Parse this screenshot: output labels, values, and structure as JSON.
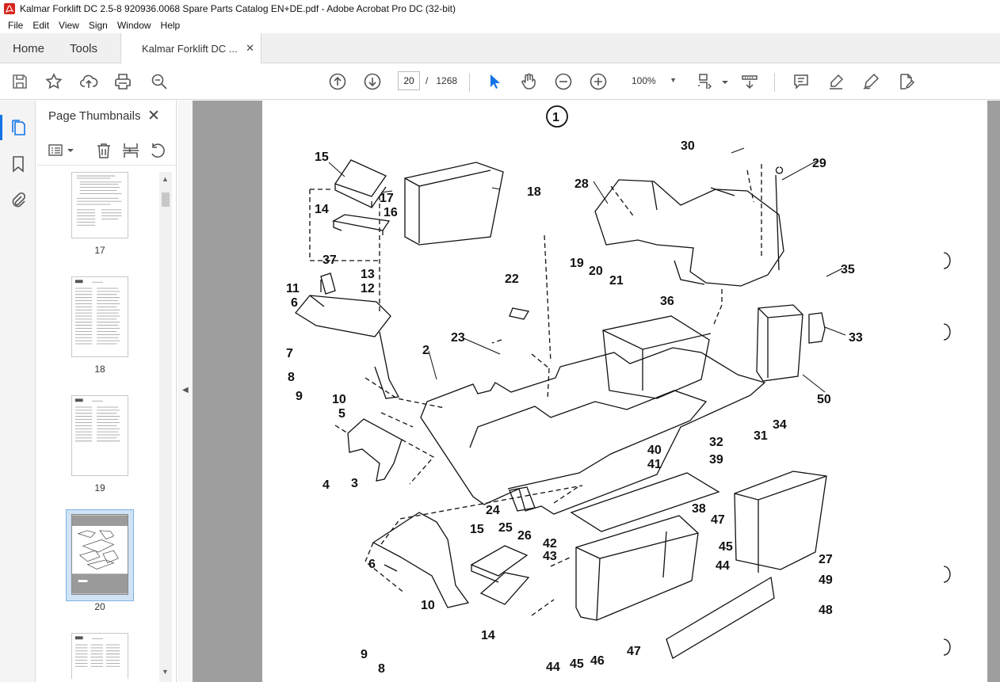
{
  "window": {
    "title": "Kalmar Forklift DC 2.5-8 920936.0068 Spare Parts Catalog EN+DE.pdf - Adobe Acrobat Pro DC (32-bit)"
  },
  "menu": [
    "File",
    "Edit",
    "View",
    "Sign",
    "Window",
    "Help"
  ],
  "tabs": {
    "home": "Home",
    "tools": "Tools",
    "document": "Kalmar Forklift DC ...",
    "close": "✕"
  },
  "toolbar": {
    "icons": [
      "save-icon",
      "bookmark-star-icon",
      "upload-cloud-icon",
      "print-icon",
      "zoom-find-icon",
      "page-up-icon",
      "page-down-icon",
      "select-arrow-icon",
      "hand-icon",
      "zoom-out-icon",
      "zoom-in-icon",
      "fit-page-icon",
      "scroll-mode-icon",
      "comment-icon",
      "highlight-pen-icon",
      "sign-pen-icon",
      "edit-export-icon"
    ],
    "current_page": "20",
    "page_sep": "/",
    "total_pages": "1268",
    "zoom": "100%"
  },
  "sidebar": {
    "title": "Page Thumbnails",
    "close": "✕",
    "thumbnails": [
      {
        "label": "17"
      },
      {
        "label": "18"
      },
      {
        "label": "19"
      },
      {
        "label": "20",
        "selected": true
      },
      {
        "label": ""
      }
    ]
  },
  "document": {
    "figure_number": "1",
    "part_labels": [
      "1",
      "2",
      "3",
      "4",
      "5",
      "6",
      "7",
      "8",
      "9",
      "10",
      "11",
      "12",
      "13",
      "14",
      "15",
      "16",
      "17",
      "18",
      "19",
      "20",
      "21",
      "22",
      "23",
      "24",
      "25",
      "26",
      "27",
      "28",
      "29",
      "30",
      "31",
      "32",
      "33",
      "34",
      "35",
      "36",
      "37",
      "38",
      "39",
      "40",
      "41",
      "42",
      "43",
      "44",
      "45",
      "46",
      "47",
      "48",
      "49",
      "50"
    ]
  }
}
